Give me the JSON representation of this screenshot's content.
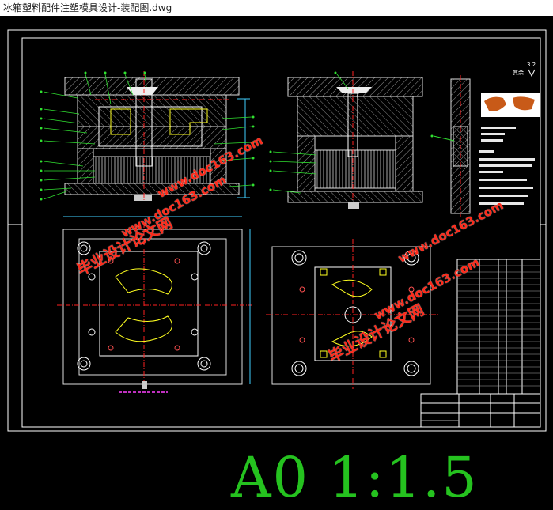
{
  "window": {
    "title": "冰箱塑料配件注塑模具设计-装配图.dwg"
  },
  "drawing": {
    "scale_label": "A0 1:1.5",
    "roughness_mark": "其余",
    "watermarks": [
      {
        "url": "www.doc163.com",
        "site": "毕业设计论文网"
      },
      {
        "url": "www.doc163.com",
        "site": "毕业设计论文网"
      }
    ]
  },
  "colors": {
    "background": "#000000",
    "frame": "#ffffff",
    "plates": "#d8d8d8",
    "hatch": "#a0a0a0",
    "centerline": "#ff2020",
    "part_yellow": "#ffff20",
    "dimension": "#40d0ff",
    "leader": "#30e030",
    "scale_label": "#25c21f",
    "watermark": "#ff2a1a",
    "thumb_part": "#c85a18"
  }
}
